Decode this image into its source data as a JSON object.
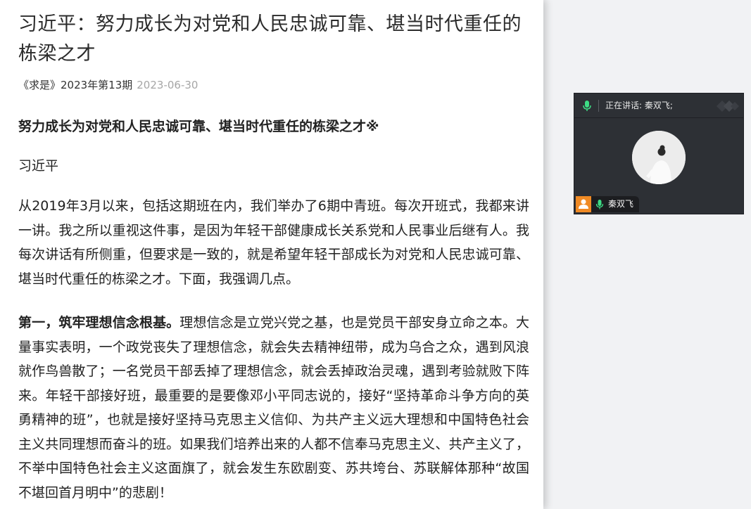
{
  "article": {
    "title": "习近平：努力成长为对党和人民忠诚可靠、堪当时代重任的栋梁之才",
    "source": "《求是》2023年第13期",
    "date": "2023-06-30",
    "subtitle": "努力成长为对党和人民忠诚可靠、堪当时代重任的栋梁之才※",
    "author": "习近平",
    "paragraph1": "从2019年3月以来，包括这期班在内，我们举办了6期中青班。每次开班式，我都来讲一讲。我之所以重视这件事，是因为年轻干部健康成长关系党和人民事业后继有人。我每次讲话有所侧重，但要求是一致的，就是希望年轻干部成长为对党和人民忠诚可靠、堪当时代重任的栋梁之才。下面，我强调几点。",
    "paragraph2_lead": "第一，筑牢理想信念根基。",
    "paragraph2_body": "理想信念是立党兴党之基，也是党员干部安身立命之本。大量事实表明，一个政党丧失了理想信念，就会失去精神纽带，成为乌合之众，遇到风浪就作鸟兽散了；一名党员干部丢掉了理想信念，就会丢掉政治灵魂，遇到考验就败下阵来。年轻干部接好班，最重要的是要像邓小平同志说的，接好“坚持革命斗争方向的英勇精神的班”，也就是接好坚持马克思主义信仰、为共产主义远大理想和中国特色社会主义共同理想而奋斗的班。如果我们培养出来的人都不信奉马克思主义、共产主义了，不举中国特色社会主义这面旗了，就会发生东欧剧变、苏共垮台、苏联解体那种“故国不堪回首月明中”的悲剧！"
  },
  "call": {
    "speaking_label": "正在讲话:",
    "speaking_name": "秦双飞;",
    "participant_name": "秦双飞",
    "accent_color": "#f08a24",
    "mic_color": "#3ddc84",
    "icons": [
      "microphone-icon",
      "app-logo-icon",
      "user-icon"
    ]
  }
}
